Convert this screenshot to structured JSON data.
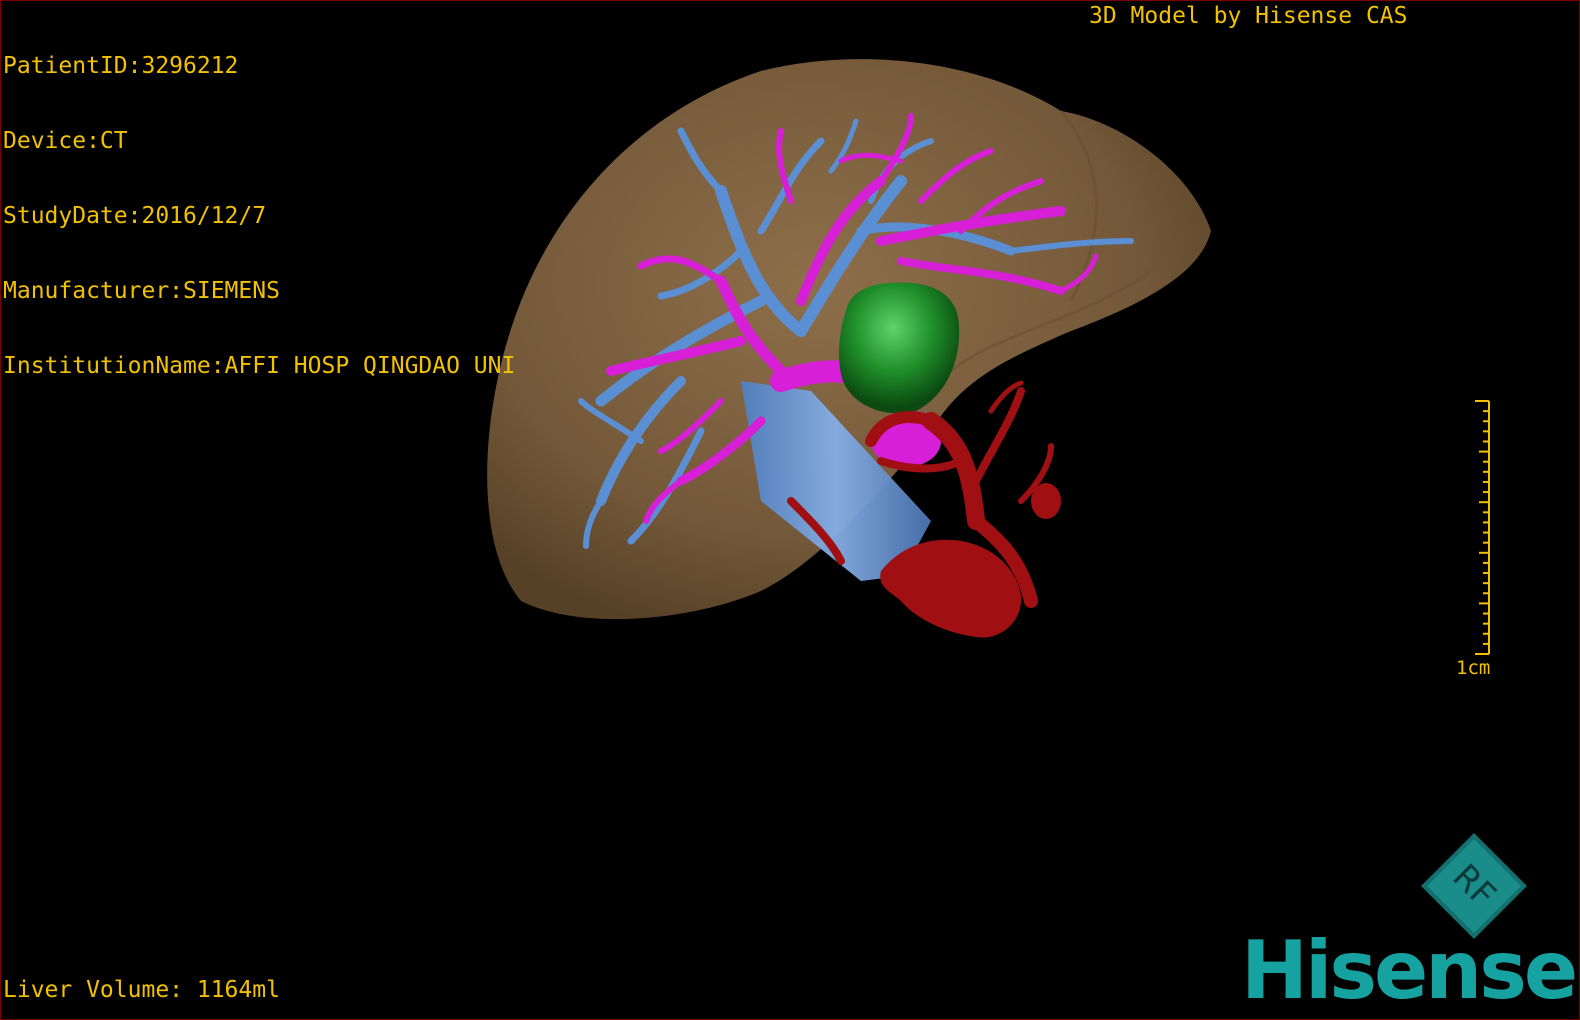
{
  "overlay": {
    "patient_id": "PatientID:3296212",
    "device": "Device:CT",
    "study_date": "StudyDate:2016/12/7",
    "manufacturer": "Manufacturer:SIEMENS",
    "institution": "InstitutionName:AFFI HOSP QINGDAO UNI",
    "credit": "3D Model by Hisense CAS",
    "liver_volume": "Liver Volume: 1164ml",
    "scale_label": "1cm"
  },
  "logo": {
    "mark_text": "RF",
    "brand": "Hisense"
  },
  "colors": {
    "overlay_text": "#f2c200",
    "liver": "#8a6a45",
    "portal_vein": "#5b8fd4",
    "hepatic_vein": "#d61fd6",
    "tumor": "#1f8f2a",
    "artery": "#a00f12",
    "brand": "#16a2a0"
  }
}
